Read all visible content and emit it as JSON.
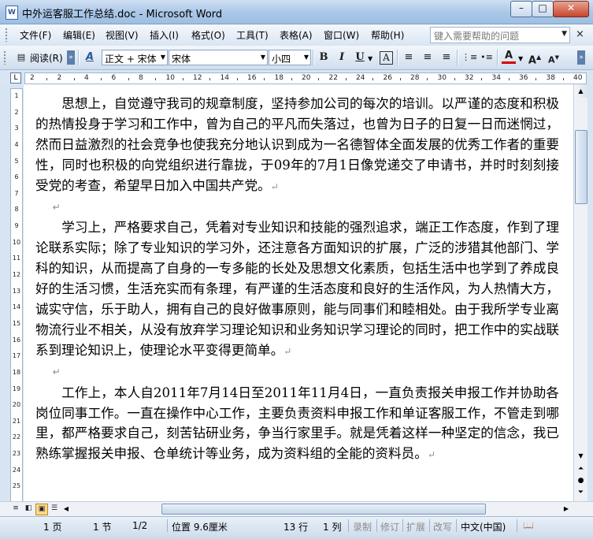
{
  "window": {
    "title": "中外运客服工作总结.doc - Microsoft Word",
    "app_icon": "W",
    "minimize": "–",
    "maximize": "□",
    "close": "✕"
  },
  "menu": {
    "items": [
      "文件(F)",
      "编辑(E)",
      "视图(V)",
      "插入(I)",
      "格式(O)",
      "工具(T)",
      "表格(A)",
      "窗口(W)",
      "帮助(H)"
    ],
    "help_placeholder": "键入需要帮助的问题",
    "close_doc": "×"
  },
  "toolbar": {
    "reading_mode": "阅读(R)",
    "style_icon": "A",
    "style": "正文 + 宋体",
    "font": "宋体",
    "font_size": "小四",
    "bold": "B",
    "italic": "I",
    "underline": "U",
    "char_border": "A",
    "font_color_letter": "A",
    "grow_font": "A",
    "shrink_font": "A"
  },
  "ruler": {
    "labels": [
      "2",
      "2",
      "4",
      "6",
      "8",
      "10",
      "12",
      "14",
      "16",
      "18",
      "20",
      "22",
      "24",
      "26",
      "28",
      "30",
      "32",
      "34",
      "36",
      "38",
      "40"
    ],
    "vertical_labels": [
      "1",
      "2",
      "3",
      "4",
      "5",
      "6",
      "7",
      "8",
      "9",
      "10",
      "11",
      "12",
      "13",
      "14",
      "15",
      "16",
      "17",
      "18",
      "19",
      "20",
      "21",
      "22",
      "23",
      "24",
      "25"
    ]
  },
  "document": {
    "paragraphs": [
      "思想上，自觉遵守我司的规章制度，坚持参加公司的每次的培训。以严谨的态度和积极的热情投身于学习和工作中，曾为自己的平凡而失落过，也曾为日子的日复一日而迷惘过，然而日益激烈的社会竞争也使我充分地认识到成为一名德智体全面发展的优秀工作者的重要性，同时也积极的向党组织进行靠拢，于09年的7月1日像党递交了申请书，并时时刻刻接受党的考查，希望早日加入中国共产党。",
      "",
      "学习上，严格要求自己，凭着对专业知识和技能的强烈追求，端正工作态度，作到了理论联系实际；除了专业知识的学习外，还注意各方面知识的扩展，广泛的涉猎其他部门、学科的知识，从而提高了自身的一专多能的长处及思想文化素质，包括生活中也学到了养成良好的生活习惯，生活充实而有条理，有严谨的生活态度和良好的生活作风，为人热情大方，诚实守信，乐于助人，拥有自己的良好做事原则，能与同事们和睦相处。由于我所学专业离物流行业不相关，从没有放弃学习理论知识和业务知识学习理论的同时，把工作中的实战联系到理论知识上，使理论水平变得更简单。",
      "",
      "工作上，本人自2011年7月14日至2011年11月4日，一直负责报关申报工作并协助各岗位同事工作。一直在操作中心工作，主要负责资料申报工作和单证客服工作，不管走到哪里，都严格要求自己，刻苦钻研业务，争当行家里手。就是凭着这样一种坚定的信念，我已熟练掌握报关申报、仓单统计等业务，成为资料组的全能的资料员。"
    ],
    "para_mark": "↵"
  },
  "statusbar": {
    "page": "1 页",
    "section": "1 节",
    "page_of": "1/2",
    "position": "位置 9.6厘米",
    "line": "13 行",
    "column": "1 列",
    "rec": "录制",
    "trk": "修订",
    "ext": "扩展",
    "ovr": "改写",
    "language": "中文(中国)"
  }
}
